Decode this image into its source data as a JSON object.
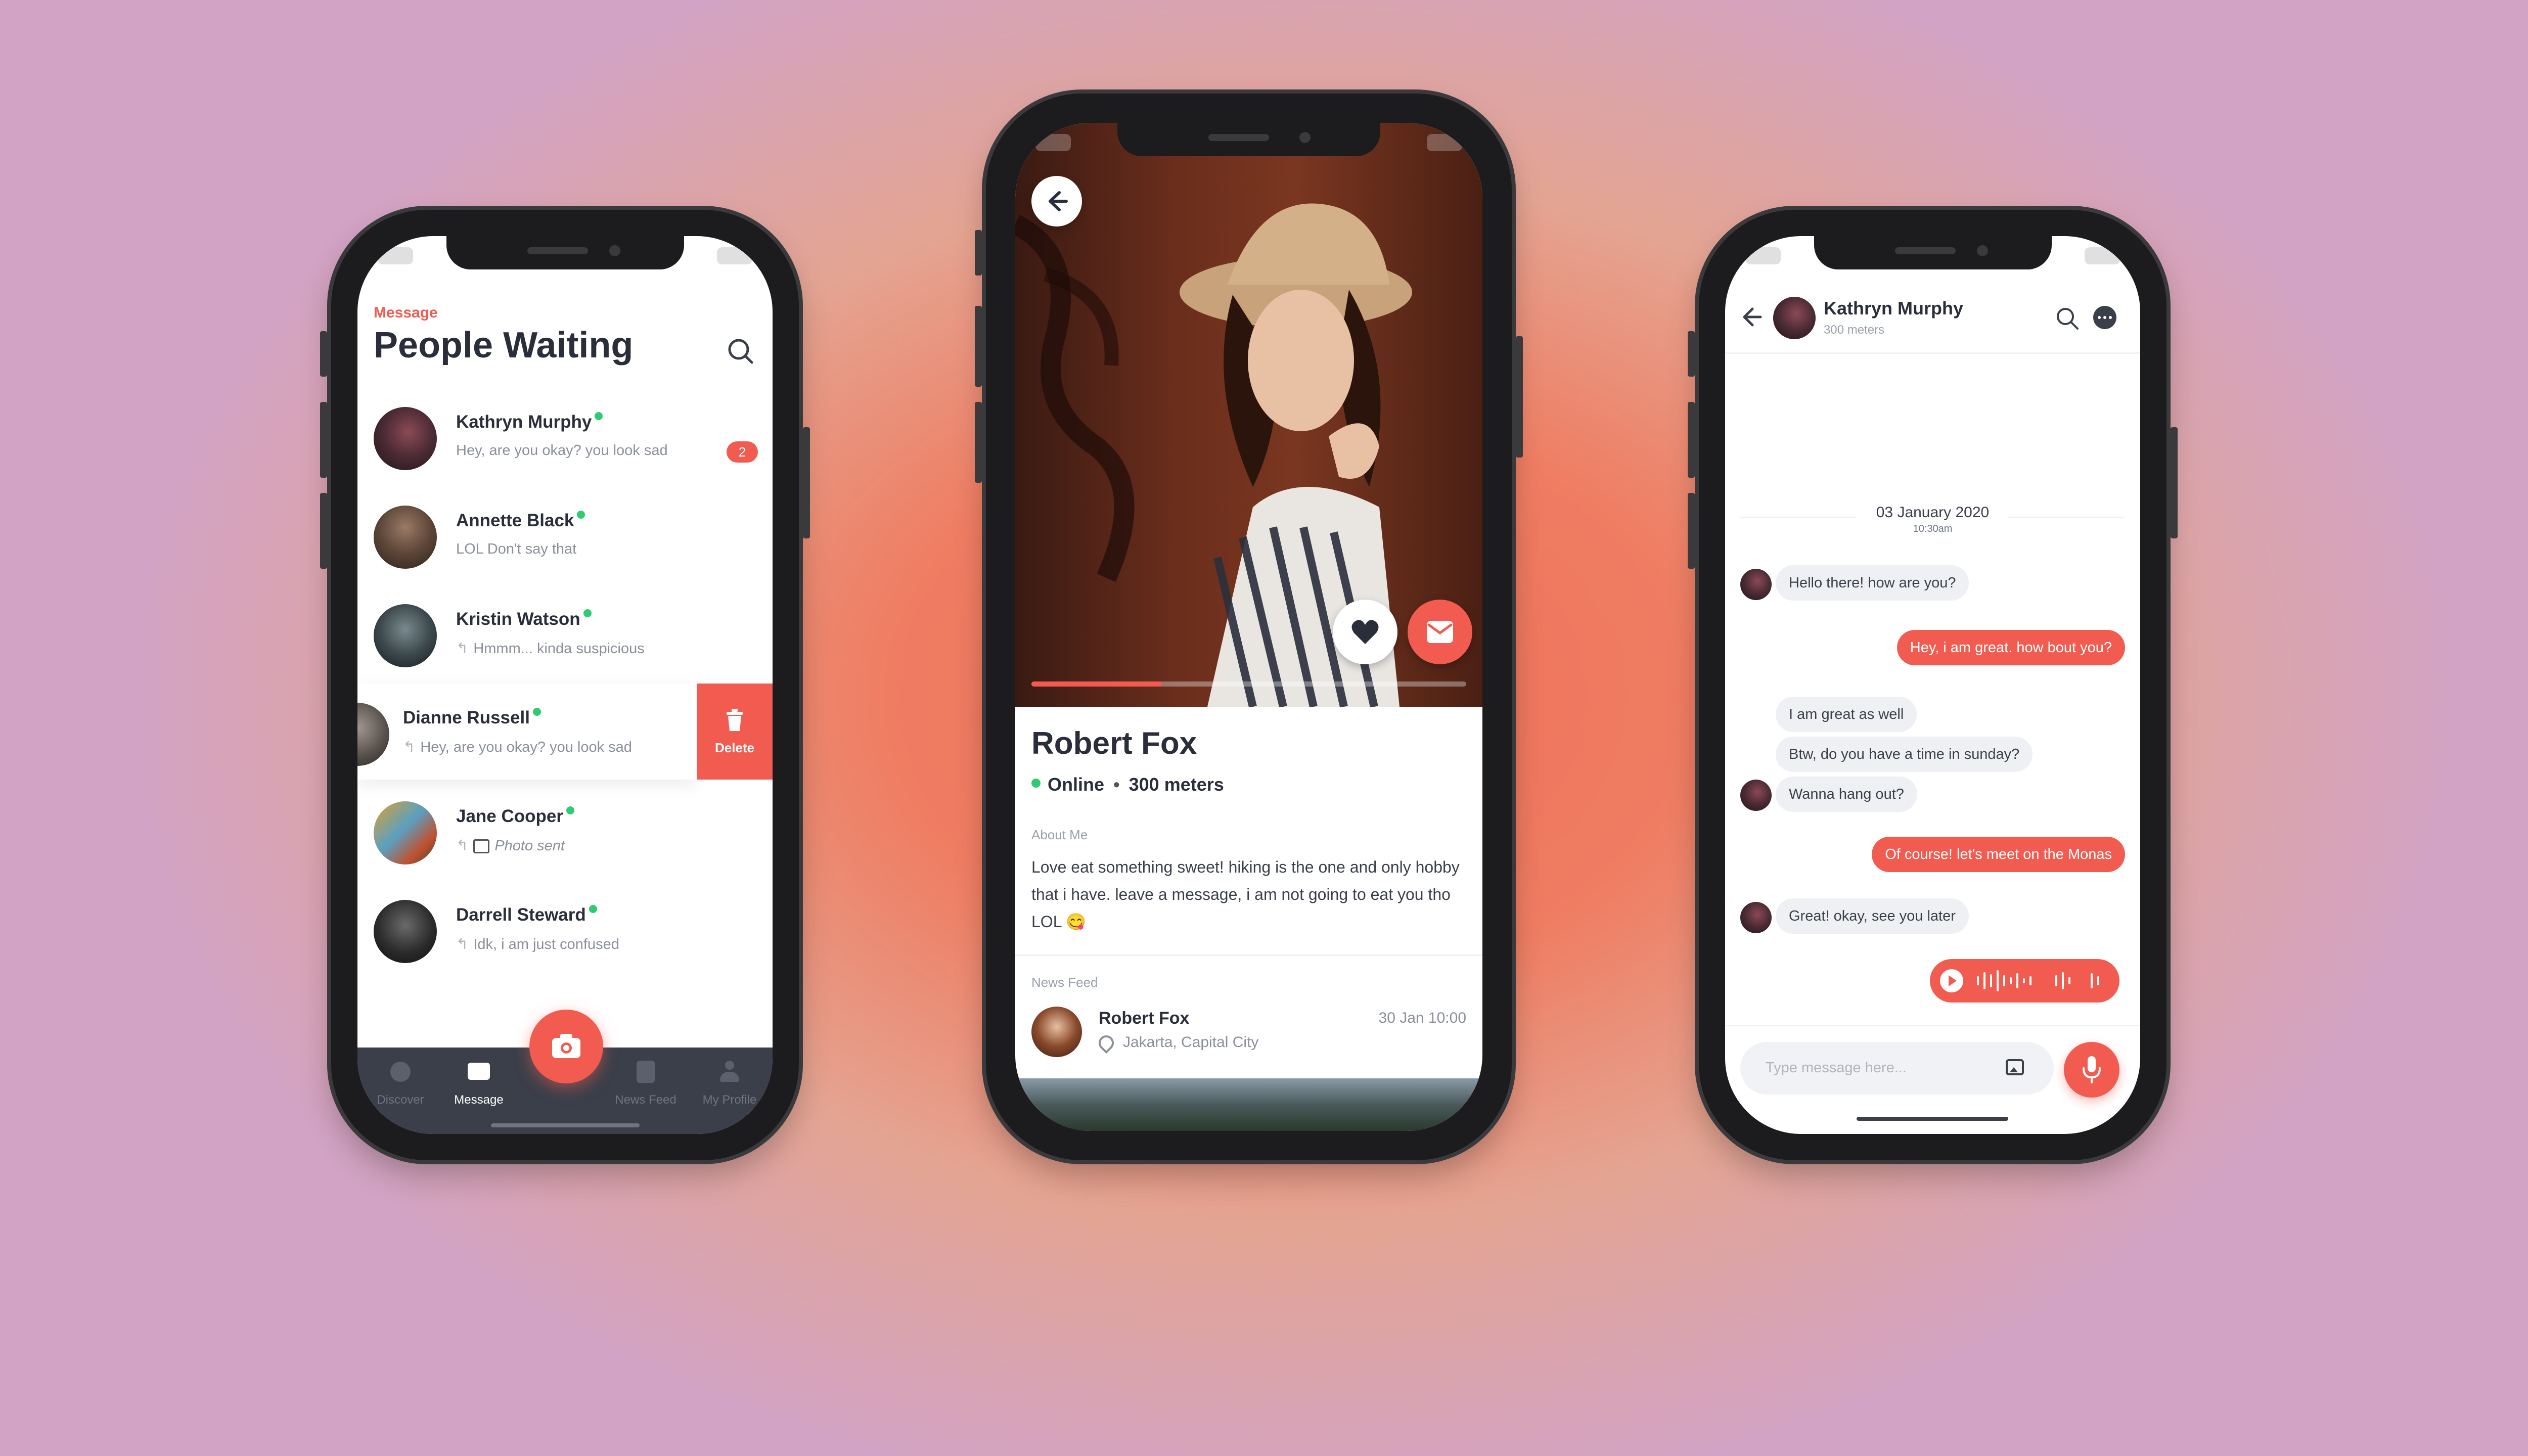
{
  "colors": {
    "accent": "#f25b50",
    "online": "#2ecc71",
    "nav_bg": "#3a3f4a"
  },
  "left_phone": {
    "section_label": "Message",
    "title": "People Waiting",
    "conversations": [
      {
        "name": "Kathryn Murphy",
        "preview": "Hey, are you okay? you look sad",
        "unread": "2"
      },
      {
        "name": "Annette Black",
        "preview": "LOL Don't say that"
      },
      {
        "name": "Kristin Watson",
        "preview": "Hmmm... kinda suspicious"
      },
      {
        "name": "Dianne Russell",
        "preview": "Hey, are you okay? you look sad"
      },
      {
        "name": "Jane Cooper",
        "preview": "Photo sent"
      },
      {
        "name": "Darrell Steward",
        "preview": "Idk, i am just confused"
      }
    ],
    "delete_label": "Delete",
    "nav": {
      "discover": "Discover",
      "message": "Message",
      "news_feed": "News Feed",
      "my_profile": "My Profile"
    }
  },
  "middle_phone": {
    "name": "Robert Fox",
    "status": "Online",
    "distance": "300 meters",
    "about_label": "About Me",
    "about_text": "Love eat something sweet! hiking is the one and only hobby that i have. leave a message, i am not going to eat you tho LOL 😋",
    "news_label": "News Feed",
    "news": {
      "author": "Robert Fox",
      "location": "Jakarta, Capital City",
      "time": "30 Jan 10:00"
    },
    "progress": 0.3
  },
  "right_phone": {
    "contact_name": "Kathryn Murphy",
    "contact_distance": "300 meters",
    "date": "03 January 2020",
    "time": "10:30am",
    "messages": {
      "m1": "Hello there! how are you?",
      "m2": "Hey, i am great. how bout you?",
      "m3": "I am great as well",
      "m4": "Btw, do you have a time in sunday?",
      "m5": "Wanna hang out?",
      "m6": "Of course! let's meet on the Monas",
      "m7": "Great! okay, see you later"
    },
    "input_placeholder": "Type message here..."
  }
}
